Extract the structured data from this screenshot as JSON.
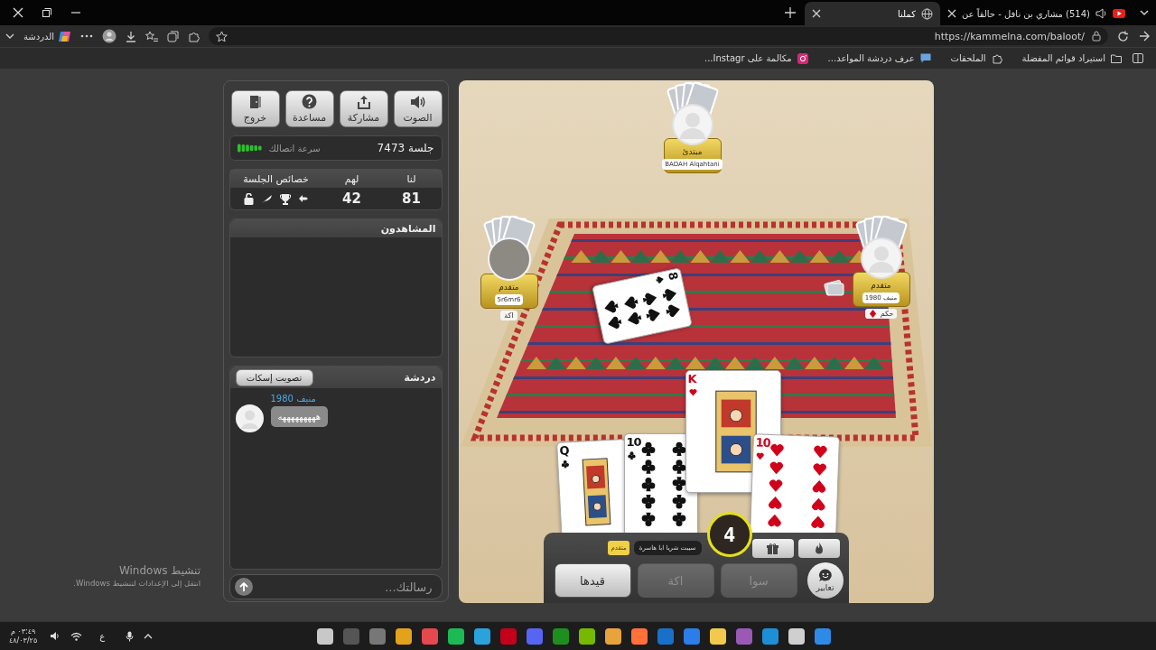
{
  "browser": {
    "tabs": [
      {
        "title": "(514) مشاري بن نافل - حالقاً عن",
        "selected": false,
        "audio": true,
        "kind": "video"
      },
      {
        "title": "كملنا",
        "selected": true,
        "audio": false,
        "kind": "web"
      }
    ],
    "url": "https://kammelna.com/baloot/",
    "sidebar_button": "الدردشة",
    "bookmarks": [
      {
        "label": "استيراد قوائم المفضلة",
        "kind": "import"
      },
      {
        "label": "الملحقات",
        "kind": "extensions"
      },
      {
        "label": "عرف دردشة المواعد...",
        "kind": "chat"
      },
      {
        "label": "مكالمة على Instagr...",
        "kind": "instagram"
      }
    ]
  },
  "panel": {
    "buttons": [
      {
        "label": "الصوت",
        "kind": "sound"
      },
      {
        "label": "مشاركة",
        "kind": "share"
      },
      {
        "label": "مساعدة",
        "kind": "help"
      },
      {
        "label": "خروج",
        "kind": "exit"
      }
    ],
    "session": {
      "label": "جلسة 7473",
      "connection_label": "سرعة اتصالك"
    },
    "scores": {
      "columns": [
        "لنا",
        "لهم",
        "خصائص الجلسة"
      ],
      "values": [
        "81",
        "42"
      ]
    },
    "spectators": {
      "title": "المشاهدون"
    },
    "chat": {
      "title": "دردشة",
      "mute_vote_button": "تصويت إسكات",
      "messages": [
        {
          "sender": "منيف 1980",
          "text": "هههههههههه"
        }
      ],
      "input": {
        "placeholder": "رسالتك..."
      }
    }
  },
  "game": {
    "players": [
      {
        "kind": "default",
        "rank": "مبتدئ",
        "name": "BADAH Alqahtani"
      },
      {
        "kind": "default",
        "rank": "متقدم",
        "name": "منيف 1980",
        "bid": {
          "text": "حكم",
          "kind": "diamonds"
        }
      },
      {
        "kind": "photo",
        "rank": "متقدم",
        "name": "5r6mr6",
        "bid": {
          "text": "اكة",
          "kind": "plain"
        }
      }
    ],
    "table_cards": [
      {
        "rank": "8",
        "kind": "spades"
      }
    ],
    "hand_cards": [
      {
        "rank": "Q",
        "kind": "clubs"
      },
      {
        "rank": "10",
        "kind": "clubs"
      },
      {
        "rank": "K",
        "kind": "hearts"
      },
      {
        "rank": "10",
        "kind": "hearts"
      }
    ],
    "timer": "4",
    "toast": "سيبت شريا ابا هاسرة",
    "toast_badge": "متقدم",
    "actions": [
      {
        "label": "سوا",
        "disabled": true
      },
      {
        "label": "اكة",
        "disabled": true
      },
      {
        "label": "قيدها",
        "disabled": false
      }
    ],
    "emotes_button": "تعابير"
  },
  "activation": {
    "title": "تنشيط Windows",
    "hint": "انتقل إلى الإعدادات لتنشيط Windows."
  },
  "taskbar": {
    "time": "٠٣:٤٩ م",
    "date": "٤٨/٠٣/٢٥",
    "language": "ع"
  }
}
